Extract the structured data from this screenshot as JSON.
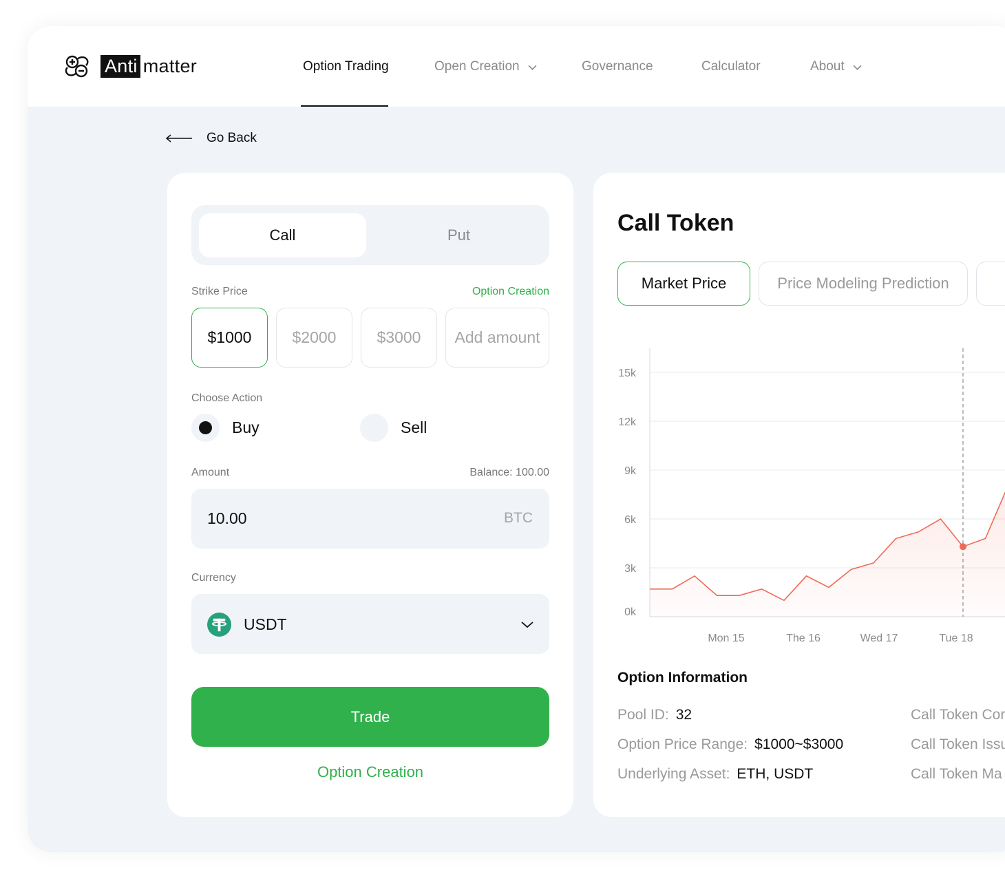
{
  "brand": {
    "box_text": "Anti",
    "rest_text": "matter"
  },
  "nav": {
    "items": [
      {
        "label": "Option Trading",
        "active": true
      },
      {
        "label": "Open Creation",
        "dropdown": true
      },
      {
        "label": "Governance"
      },
      {
        "label": "Calculator"
      },
      {
        "label": "About",
        "dropdown": true
      }
    ]
  },
  "go_back": "Go Back",
  "trade_panel": {
    "tabs": {
      "call": "Call",
      "put": "Put"
    },
    "strike_label": "Strike Price",
    "strike_link": "Option Creation",
    "strikes": [
      "$1000",
      "$2000",
      "$3000",
      "Add amount"
    ],
    "selected_strike": "$1000",
    "action_label": "Choose Action",
    "actions": {
      "buy": "Buy",
      "sell": "Sell"
    },
    "selected_action": "Buy",
    "amount_label": "Amount",
    "balance": "Balance: 100.00",
    "amount_value": "10.00",
    "amount_unit": "BTC",
    "currency_label": "Currency",
    "currency_value": "USDT",
    "trade_button": "Trade",
    "bottom_link": "Option Creation"
  },
  "detail_panel": {
    "title": "Call Token",
    "tabs": [
      "Market Price",
      "Price Modeling Prediction"
    ],
    "selected_tab": "Market Price",
    "info_title": "Option Information",
    "info": [
      {
        "key": "Pool ID:",
        "value": "32"
      },
      {
        "key": "Option Price Range:",
        "value": "$1000~$3000"
      },
      {
        "key": "Underlying Asset:",
        "value": "ETH, USDT"
      }
    ],
    "info_right": [
      "Call Token Cor",
      "Call Token Issu",
      "Call Token Ma"
    ]
  },
  "colors": {
    "accent": "#31b14b",
    "line": "#ef6a57",
    "background": "#f0f3f7"
  },
  "chart_data": {
    "type": "area",
    "y_ticks": [
      "15k",
      "12k",
      "9k",
      "6k",
      "3k",
      "0k"
    ],
    "ylim": [
      0,
      15000
    ],
    "x_ticks": [
      "Mon 15",
      "The 16",
      "Wed 17",
      "Tue 18"
    ],
    "grid": true,
    "series": [
      {
        "values": [
          1700,
          1700,
          2500,
          1300,
          1300,
          1700,
          1000,
          2500,
          1800,
          2900,
          3300,
          4800,
          5200,
          6000,
          4300,
          4800,
          8000
        ]
      }
    ],
    "highlight_index": 14
  }
}
